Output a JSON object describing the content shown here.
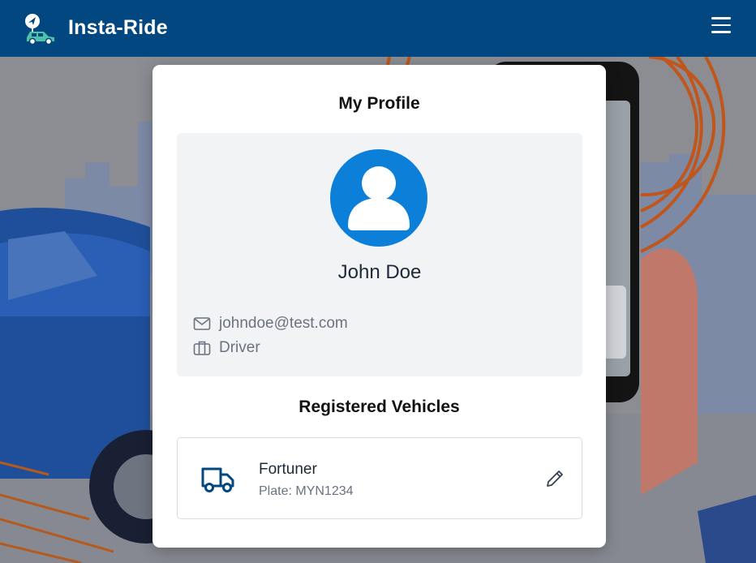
{
  "app": {
    "brand": "Insta-Ride",
    "logo_icon": "car-location-icon",
    "menu_icon": "hamburger-menu-icon"
  },
  "profile": {
    "heading": "My Profile",
    "name": "John Doe",
    "email": "johndoe@test.com",
    "role": "Driver",
    "avatar_icon": "user-avatar-icon",
    "email_icon": "mail-icon",
    "role_icon": "briefcase-icon"
  },
  "vehicles": {
    "heading": "Registered Vehicles",
    "items": [
      {
        "name": "Fortuner",
        "plate": "Plate: MYN1234",
        "icon": "truck-icon",
        "action_icon": "pencil-icon"
      }
    ]
  },
  "colors": {
    "header_bg": "#02477f",
    "accent": "#0c7fd9",
    "panel_bg": "#f2f3f5",
    "text_muted": "#6b7280"
  }
}
